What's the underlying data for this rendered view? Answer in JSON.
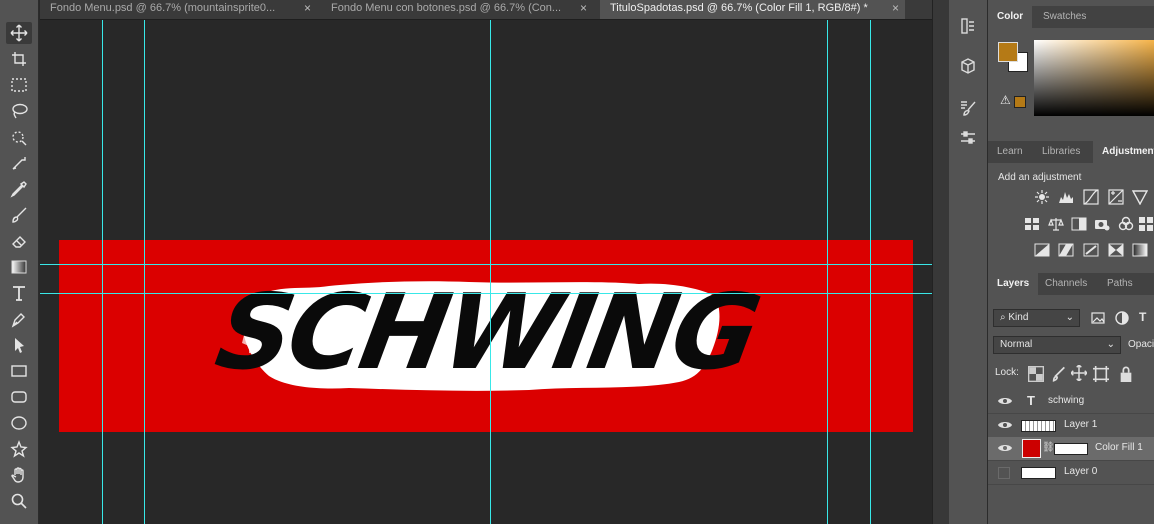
{
  "tabs": [
    {
      "label": "Fondo Menu.psd @ 66.7% (mountainsprite0...",
      "close": "×"
    },
    {
      "label": "Fondo Menu con botones.psd @ 66.7% (Con...",
      "close": "×"
    },
    {
      "label": "TituloSpadotas.psd @ 66.7% (Color Fill 1, RGB/8#) *",
      "close": "×"
    }
  ],
  "canvas": {
    "doc_fill": "#db0000",
    "title_text": "SCHWING",
    "guide_color": "#38e8e8"
  },
  "color_panel": {
    "tabs": [
      "Color",
      "Swatches"
    ],
    "foreground": "#b57a16",
    "background": "#ffffff",
    "gamut_swatch": "#b57a16"
  },
  "adjustments_panel": {
    "tabs": [
      "Learn",
      "Libraries",
      "Adjustments"
    ],
    "heading": "Add an adjustment"
  },
  "layers_panel": {
    "tabs": [
      "Layers",
      "Channels",
      "Paths"
    ],
    "filter_kind": "Kind",
    "blend_mode": "Normal",
    "opacity_label": "Opaci",
    "lock_label": "Lock:",
    "layers": [
      {
        "name": "schwing",
        "type": "text",
        "visible": true
      },
      {
        "name": "Layer 1",
        "type": "pixel",
        "visible": true
      },
      {
        "name": "Color Fill 1",
        "type": "fill",
        "visible": true,
        "selected": true,
        "swatch": "#cc0000"
      },
      {
        "name": "Layer 0",
        "type": "pixel",
        "visible": false
      }
    ]
  }
}
